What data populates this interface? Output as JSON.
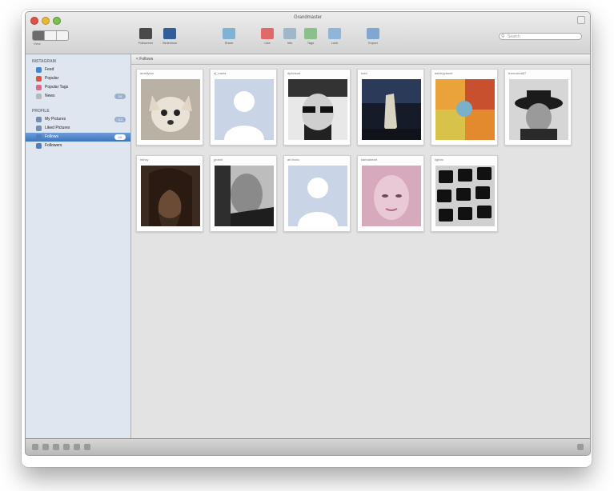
{
  "window": {
    "title": "Grandmaster"
  },
  "toolbar": {
    "view_label": "View",
    "tools": [
      {
        "label": "Fullscreen",
        "icon": "monitor-icon",
        "color": "#4a4a4a"
      },
      {
        "label": "Slideshow",
        "icon": "book-icon",
        "color": "#2f5f9a"
      },
      {
        "label": "Share",
        "icon": "share-icon",
        "color": "#7fb3d6"
      },
      {
        "label": "Like",
        "icon": "heart-icon",
        "color": "#e06a6a"
      },
      {
        "label": "Info",
        "icon": "chat-icon",
        "color": "#9fb7c9"
      },
      {
        "label": "Tags",
        "icon": "tag-icon",
        "color": "#8cc08a"
      },
      {
        "label": "Lock",
        "icon": "lock-icon",
        "color": "#8fb5d8"
      },
      {
        "label": "Export",
        "icon": "export-icon",
        "color": "#7fa7cf"
      }
    ],
    "search_placeholder": "Search"
  },
  "sidebar": {
    "sections": [
      {
        "header": "Instagram",
        "items": [
          {
            "label": "Feed",
            "icon": "feed-icon",
            "color": "#3f86d8",
            "badge": ""
          },
          {
            "label": "Popular",
            "icon": "popular-icon",
            "color": "#e4503c",
            "badge": ""
          },
          {
            "label": "Popular Tags",
            "icon": "tags-icon",
            "color": "#d86b8b",
            "badge": ""
          },
          {
            "label": "News",
            "icon": "news-icon",
            "color": "#b9b9b9",
            "badge": "24"
          }
        ]
      },
      {
        "header": "Profile",
        "items": [
          {
            "label": "My Pictures",
            "icon": "pictures-icon",
            "color": "#6f8fb3",
            "badge": "115"
          },
          {
            "label": "Liked Pictures",
            "icon": "liked-icon",
            "color": "#6f8fb3",
            "badge": ""
          },
          {
            "label": "Follows",
            "icon": "follows-icon",
            "color": "#4d7fbf",
            "badge": "10",
            "selected": true
          },
          {
            "label": "Followers",
            "icon": "followers-icon",
            "color": "#4d7fbf",
            "badge": ""
          }
        ]
      }
    ]
  },
  "content": {
    "breadcrumb": "< Follows",
    "users": [
      {
        "name": "ameliyam",
        "photo": "chihuahua"
      },
      {
        "name": "dj_maria",
        "photo": "placeholder"
      },
      {
        "name": "djchrisart",
        "photo": "man-sunglasses"
      },
      {
        "name": "ludd",
        "photo": "dark-figure"
      },
      {
        "name": "ashleyplanet",
        "photo": "colorful"
      },
      {
        "name": "francokrat67",
        "photo": "man-hat"
      },
      {
        "name": "mihzy",
        "photo": "woman-dark"
      },
      {
        "name": "jpranti",
        "photo": "man-bw"
      },
      {
        "name": "ari.frodo",
        "photo": "placeholder"
      },
      {
        "name": "karinaheart",
        "photo": "woman-pink"
      },
      {
        "name": "kgfoto",
        "photo": "keyboard"
      }
    ]
  },
  "bottombar": {
    "left_buttons": [
      "plus-icon",
      "minus-icon",
      "gear-icon",
      "refresh-icon",
      "eye-icon",
      "info-icon"
    ],
    "right_buttons": [
      "resize-icon"
    ]
  }
}
